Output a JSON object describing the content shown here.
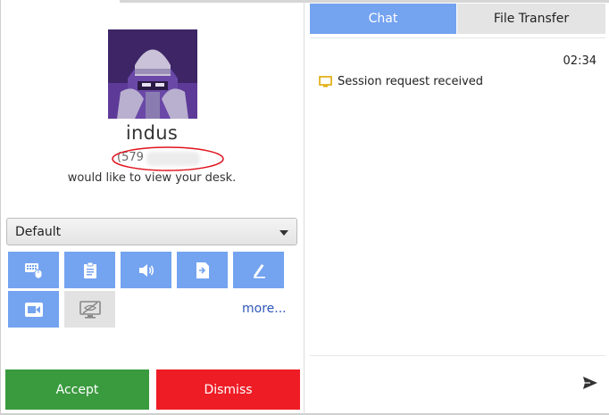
{
  "user": {
    "name": "indus",
    "id_prefix": "(579",
    "request_message": "would like to view your desk."
  },
  "permissions": {
    "profile_select": "Default",
    "items": [
      {
        "icon": "keyboard-mouse-icon",
        "enabled": true
      },
      {
        "icon": "clipboard-icon",
        "enabled": true
      },
      {
        "icon": "speaker-icon",
        "enabled": true
      },
      {
        "icon": "file-transfer-icon",
        "enabled": true
      },
      {
        "icon": "pen-icon",
        "enabled": true
      },
      {
        "icon": "record-camera-icon",
        "enabled": true
      },
      {
        "icon": "privacy-screen-icon",
        "enabled": false
      }
    ],
    "more_label": "more..."
  },
  "actions": {
    "accept_label": "Accept",
    "dismiss_label": "Dismiss",
    "accept_color": "#3a9a3e",
    "dismiss_color": "#ee1c25"
  },
  "tabs": [
    {
      "label": "Chat",
      "active": true
    },
    {
      "label": "File Transfer",
      "active": false
    }
  ],
  "chat": {
    "timestamp": "02:34",
    "event_text": "Session request received",
    "event_icon": "monitor-icon"
  },
  "colors": {
    "accent": "#74a3f0",
    "highlight_ellipse": "#e0141e",
    "event_icon": "#e0a800"
  }
}
